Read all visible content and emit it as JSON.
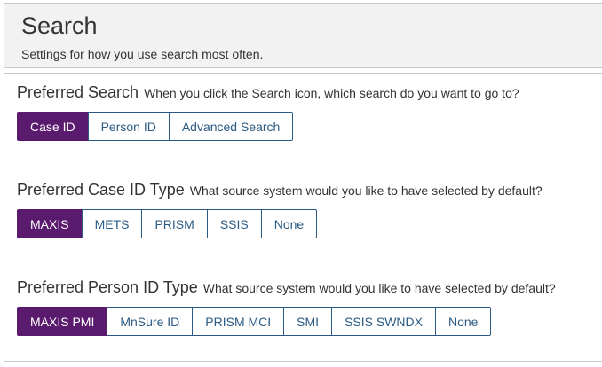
{
  "header": {
    "title": "Search",
    "subtitle": "Settings for how you use search most often."
  },
  "sections": [
    {
      "heading": "Preferred Search",
      "description": "When you click the Search icon, which search do you want to go to?",
      "options": [
        "Case ID",
        "Person ID",
        "Advanced Search"
      ],
      "selected": "Case ID"
    },
    {
      "heading": "Preferred Case ID Type",
      "description": "What source system would you like to have selected by default?",
      "options": [
        "MAXIS",
        "METS",
        "PRISM",
        "SSIS",
        "None"
      ],
      "selected": "MAXIS"
    },
    {
      "heading": "Preferred Person ID Type",
      "description": "What source system would you like to have selected by default?",
      "options": [
        "MAXIS PMI",
        "MnSure ID",
        "PRISM MCI",
        "SMI",
        "SSIS SWNDX",
        "None"
      ],
      "selected": "MAXIS PMI"
    }
  ],
  "colors": {
    "selected_bg": "#5a1a6e",
    "button_text": "#2b5b84",
    "header_bg": "#f2f2f2"
  }
}
